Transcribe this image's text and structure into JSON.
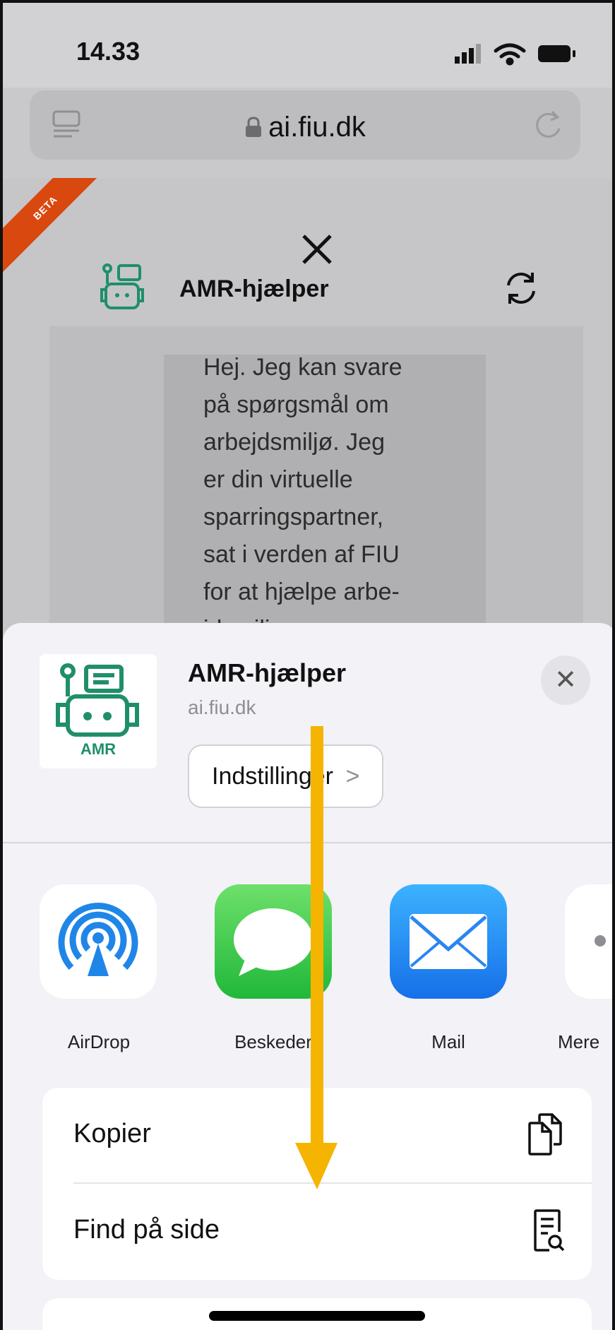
{
  "status_bar": {
    "time": "14.33"
  },
  "browser": {
    "url": "ai.fiu.dk"
  },
  "page": {
    "beta_label": "BETA",
    "chat_title": "AMR-hjælper",
    "message_lines": [
      "Hej. Jeg kan svare",
      "på spørgsmål om",
      "arbejdsmiljø. Jeg",
      "er din virtuelle",
      "sparringspartner,",
      "sat i verden af FIU",
      "for at hjælpe arbe-",
      "jdsmiljørepræsen-"
    ]
  },
  "share_sheet": {
    "app_name": "AMR-hjælper",
    "domain": "ai.fiu.dk",
    "logo_text": "AMR",
    "options_label": "Indstillinger",
    "options_chevron": ">",
    "close_symbol": "✕",
    "apps": [
      {
        "label": "AirDrop",
        "icon": "airdrop-icon"
      },
      {
        "label": "Beskeder",
        "icon": "messages-icon"
      },
      {
        "label": "Mail",
        "icon": "mail-icon"
      },
      {
        "label": "Mere",
        "icon": "more-icon"
      }
    ],
    "actions": [
      {
        "label": "Kopier",
        "icon": "copy-icon"
      },
      {
        "label": "Find på side",
        "icon": "find-on-page-icon"
      }
    ]
  },
  "colors": {
    "accent_green": "#1f8f6a",
    "beta_orange": "#d9480f",
    "annotation_arrow": "#f5b400"
  }
}
